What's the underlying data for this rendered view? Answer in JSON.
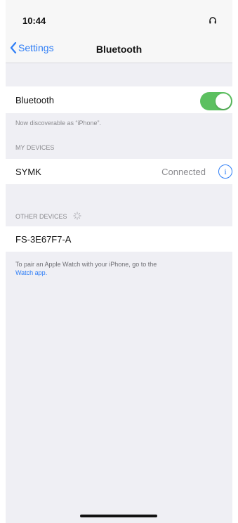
{
  "status_bar": {
    "time": "10:44",
    "audio_icon": "headphones-icon"
  },
  "nav": {
    "back_label": "Settings",
    "title": "Bluetooth"
  },
  "bluetooth": {
    "label": "Bluetooth",
    "enabled": true,
    "discoverable_text": "Now discoverable as “iPhone”."
  },
  "my_devices": {
    "header": "MY DEVICES",
    "items": [
      {
        "name": "SYMK",
        "status": "Connected"
      }
    ]
  },
  "other_devices": {
    "header": "OTHER DEVICES",
    "items": [
      {
        "name": "FS-3E67F7-A"
      }
    ]
  },
  "footnote": {
    "text": "To pair an Apple Watch with your iPhone, go to the",
    "link": "Watch app."
  },
  "colors": {
    "accent": "#2f7ef6",
    "toggle_on": "#5cc060"
  }
}
